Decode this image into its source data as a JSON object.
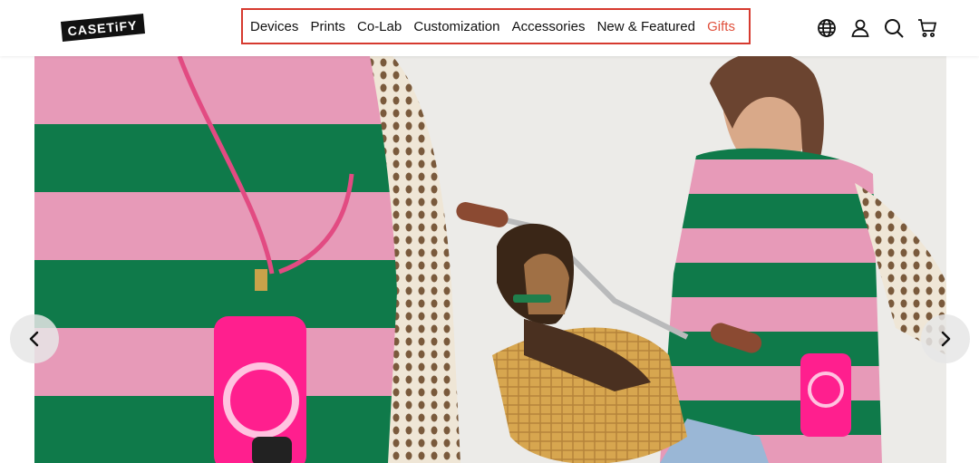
{
  "brand": {
    "logo_text": "CASETiFY",
    "colors": {
      "logo_bg": "#111111",
      "nav_highlight_border": "#d63a2f",
      "gifts_accent": "#e0503c"
    }
  },
  "nav": {
    "items": [
      {
        "label": "Devices"
      },
      {
        "label": "Prints"
      },
      {
        "label": "Co-Lab"
      },
      {
        "label": "Customization"
      },
      {
        "label": "Accessories"
      },
      {
        "label": "New & Featured"
      },
      {
        "label": "Gifts"
      }
    ]
  },
  "header_icons": [
    "globe-icon",
    "account-icon",
    "search-icon",
    "cart-icon"
  ],
  "carousel": {
    "prev_icon": "chevron-left-icon",
    "next_icon": "chevron-right-icon"
  }
}
